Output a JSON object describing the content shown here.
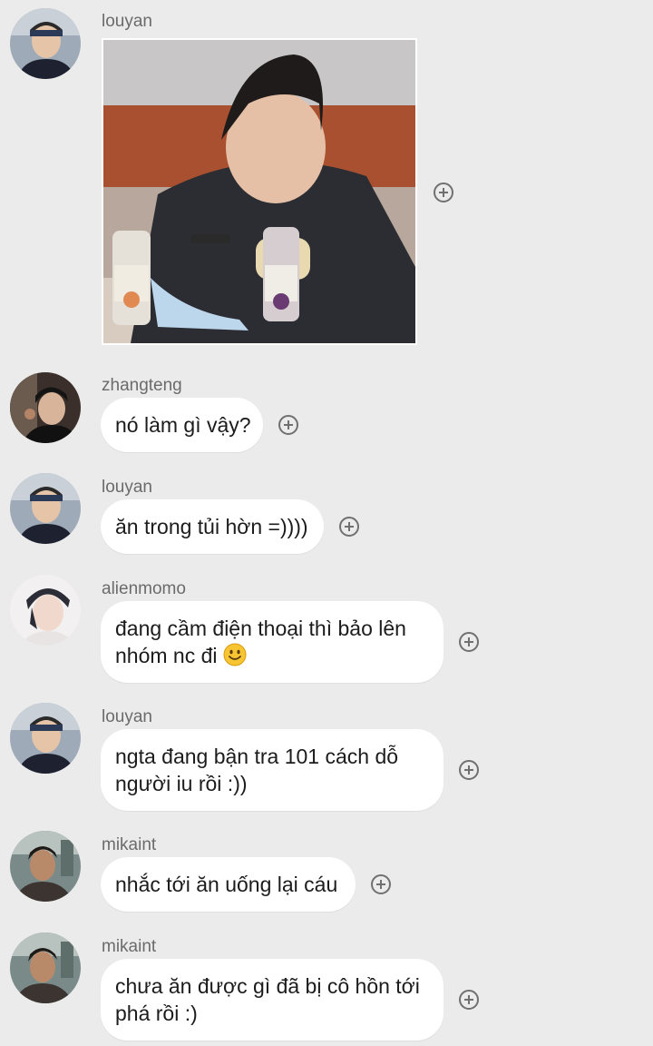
{
  "messages": [
    {
      "user": "louyan",
      "type": "image",
      "image_desc": "photo-message"
    },
    {
      "user": "zhangteng",
      "lines": [
        "nó làm gì vậy?"
      ]
    },
    {
      "user": "louyan",
      "lines": [
        "ăn trong tủi hờn =))))"
      ]
    },
    {
      "user": "alienmomo",
      "lines": [
        "đang cầm điện thoại thì bảo lên",
        "nhóm nc đi"
      ],
      "emoji": "slightly-smiling-face-icon"
    },
    {
      "user": "louyan",
      "lines": [
        "ngta đang bận tra 101 cách dỗ",
        "người iu rồi :))"
      ]
    },
    {
      "user": "mikaint",
      "lines": [
        "nhắc tới ăn uống lại cáu"
      ]
    },
    {
      "user": "mikaint",
      "lines": [
        "chưa ăn được gì đã bị cô hồn tới",
        "phá rồi :)"
      ]
    }
  ],
  "icons": {
    "react": "add-reaction-icon"
  },
  "colors": {
    "background": "#ebebeb",
    "bubble": "#ffffff",
    "text": "#1c1c1c",
    "username": "#6b6b6b",
    "icon": "#707070"
  }
}
